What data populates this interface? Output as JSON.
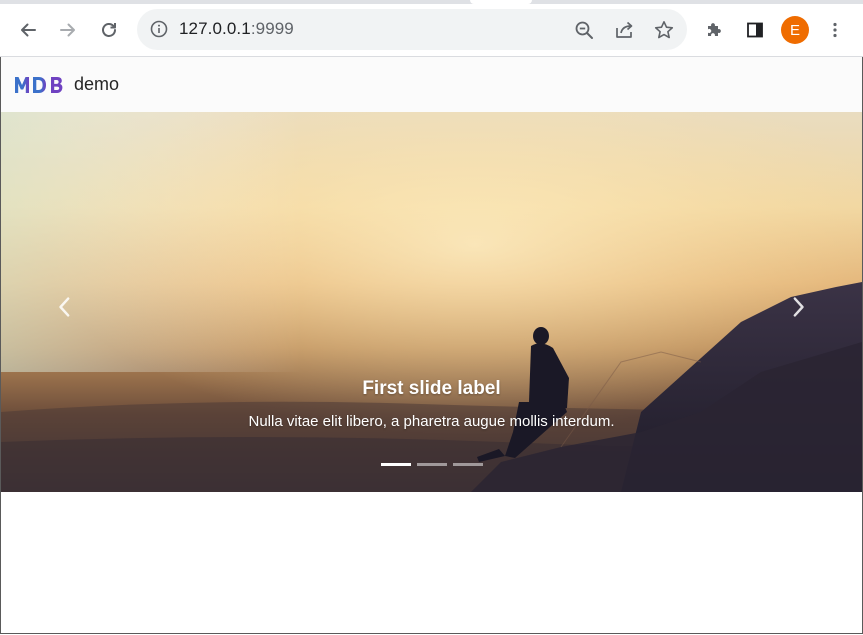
{
  "browser": {
    "url_host": "127.0.0.1",
    "url_port": ":9999",
    "profile_initial": "E",
    "icons": [
      "back-icon",
      "forward-icon",
      "reload-icon",
      "site-info-icon",
      "zoom-icon",
      "share-icon",
      "bookmark-star-icon",
      "extensions-icon",
      "side-panel-icon",
      "menu-dots-icon"
    ]
  },
  "navbar": {
    "brand_logo_text": "MDB",
    "brand_text": "demo"
  },
  "carousel": {
    "slides": [
      {
        "label": "First slide label",
        "description": "Nulla vitae elit libero, a pharetra augue mollis interdum."
      }
    ],
    "indicator_count": 3,
    "active_index": 0
  },
  "colors": {
    "avatar": "#ef6c00",
    "logo_blue": "#3b71ca",
    "logo_purple": "#6f42c1"
  }
}
